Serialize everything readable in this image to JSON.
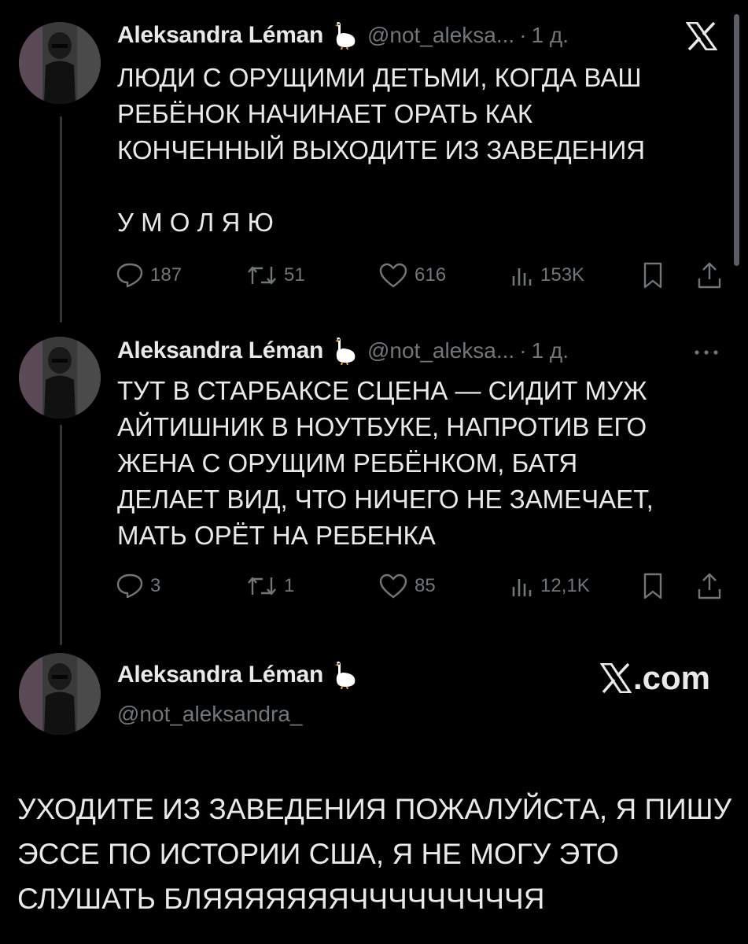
{
  "colors": {
    "background": "#000000",
    "text_primary": "#e7e9ea",
    "text_secondary": "#71767b",
    "thread_line": "#333639"
  },
  "tweets": [
    {
      "author_name": "Aleksandra Léman",
      "author_badge": "goose-icon",
      "handle": "@not_aleksa...",
      "separator": "·",
      "time": "1 д.",
      "corner_icon": "x-logo-icon",
      "text": "ЛЮДИ С ОРУЩИМИ ДЕТЬМИ, КОГДА ВАШ\nРЕБЁНОК НАЧИНАЕТ ОРАТЬ КАК\nКОНЧЕННЫЙ ВЫХОДИТЕ ИЗ ЗАВЕДЕНИЯ\n\nУ М О Л Я Ю",
      "actions": {
        "replies": "187",
        "reposts": "51",
        "likes": "616",
        "views": "153K"
      }
    },
    {
      "author_name": "Aleksandra Léman",
      "author_badge": "goose-icon",
      "handle": "@not_aleksa...",
      "separator": "·",
      "time": "1 д.",
      "corner_icon": "more-icon",
      "text": "ТУТ В СТАРБАКСЕ СЦЕНА — СИДИТ МУЖ\nАЙТИШНИК В НОУТБУКЕ, НАПРОТИВ ЕГО\nЖЕНА С ОРУЩИМ РЕБЁНКОМ, БАТЯ\nДЕЛАЕТ ВИД, ЧТО НИЧЕГО НЕ ЗАМЕЧАЕТ,\nМАТЬ ОРЁТ НА РЕБЕНКА",
      "actions": {
        "replies": "3",
        "reposts": "1",
        "likes": "85",
        "views": "12,1K"
      }
    }
  ],
  "card": {
    "author_name": "Aleksandra Léman",
    "author_badge": "goose-icon",
    "handle": "@not_aleksandra_",
    "brand": ".com",
    "text": "УХОДИТЕ ИЗ ЗАВЕДЕНИЯ ПОЖАЛУЙСТА, Я ПИШУ ЭССЕ ПО ИСТОРИИ США, Я НЕ МОГУ ЭТО СЛУШАТЬ БЛЯЯЯЯЯЯЯЧЧЧЧЧЧЧЧЧЯ"
  }
}
